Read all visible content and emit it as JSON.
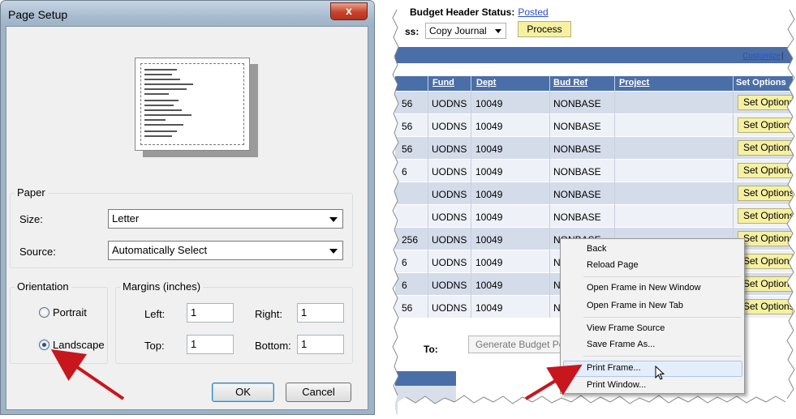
{
  "page_setup": {
    "title": "Page Setup",
    "close_glyph": "x",
    "paper": {
      "legend": "Paper",
      "size_label": "Size:",
      "size_value": "Letter",
      "source_label": "Source:",
      "source_value": "Automatically Select"
    },
    "orientation": {
      "legend": "Orientation",
      "portrait_label": "Portrait",
      "landscape_label": "Landscape",
      "selected": "Landscape"
    },
    "margins": {
      "legend": "Margins (inches)",
      "left_label": "Left:",
      "left_value": "1",
      "right_label": "Right:",
      "right_value": "1",
      "top_label": "Top:",
      "top_value": "1",
      "bottom_label": "Bottom:",
      "bottom_value": "1"
    },
    "ok_label": "OK",
    "cancel_label": "Cancel"
  },
  "browser_page": {
    "status_label": "Budget Header Status:",
    "status_link": "Posted",
    "process_select_label": "ss:",
    "process_select_value": "Copy Journal",
    "process_button": "Process",
    "customize_link": "Customize",
    "customize_sep": "|",
    "columns": [
      "Fund",
      "Dept",
      "Bud Ref",
      "Project",
      "Set Options"
    ],
    "rows": [
      {
        "prefix": "56",
        "fund": "UODNS",
        "dept": "10049",
        "bud_ref": "NONBASE",
        "button": "Set Options"
      },
      {
        "prefix": "56",
        "fund": "UODNS",
        "dept": "10049",
        "bud_ref": "NONBASE",
        "button": "Set Options"
      },
      {
        "prefix": "56",
        "fund": "UODNS",
        "dept": "10049",
        "bud_ref": "NONBASE",
        "button": "Set Options"
      },
      {
        "prefix": "6",
        "fund": "UODNS",
        "dept": "10049",
        "bud_ref": "NONBASE",
        "button": "Set Options"
      },
      {
        "prefix": "",
        "fund": "UODNS",
        "dept": "10049",
        "bud_ref": "NONBASE",
        "button": "Set Options"
      },
      {
        "prefix": "",
        "fund": "UODNS",
        "dept": "10049",
        "bud_ref": "NONBASE",
        "button": "Set Options"
      },
      {
        "prefix": "256",
        "fund": "UODNS",
        "dept": "10049",
        "bud_ref": "NONBASE",
        "button": "Set Options"
      },
      {
        "prefix": "6",
        "fund": "UODNS",
        "dept": "10049",
        "bud_ref": "N",
        "button": "Set Options"
      },
      {
        "prefix": "6",
        "fund": "UODNS",
        "dept": "10049",
        "bud_ref": "N",
        "button": "Set Options"
      },
      {
        "prefix": "56",
        "fund": "UODNS",
        "dept": "10049",
        "bud_ref": "N",
        "button": "Set Options"
      }
    ],
    "to_label": "To:",
    "generate_button": "Generate Budget Pe"
  },
  "context_menu": {
    "items": [
      "Back",
      "Reload Page",
      "Open Frame in New Window",
      "Open Frame in New Tab",
      "View Frame Source",
      "Save Frame As...",
      "Print Frame...",
      "Print Window..."
    ],
    "highlighted": "Print Frame..."
  },
  "colors": {
    "annotation_arrow": "#c8161d",
    "header_blue": "#4a6ea8",
    "button_yellow": "#f6f1a2",
    "link_blue": "#2a4ed0"
  }
}
